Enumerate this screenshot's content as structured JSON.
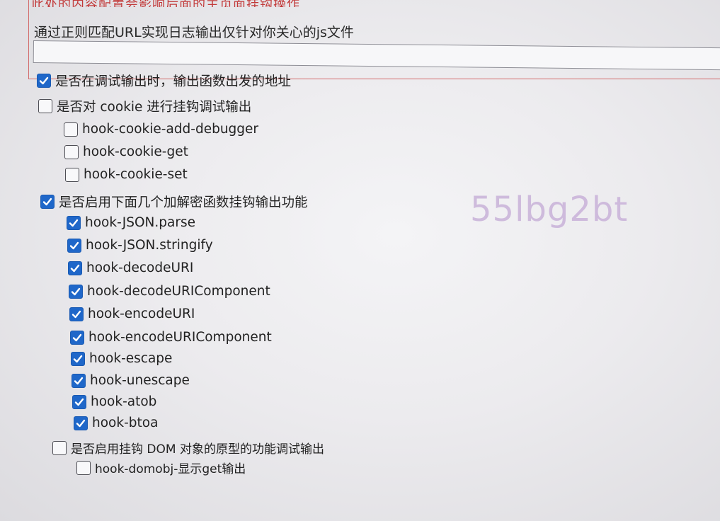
{
  "header": {
    "cut_text": "此处的内容配置会影响后面的主页面挂钩操作",
    "url_filter_label": "通过正则匹配URL实现日志输出仅针对你关心的js文件",
    "url_filter_value": ""
  },
  "options": [
    {
      "label": "是否在调试输出时，输出函数出发的地址",
      "checked": true
    },
    {
      "label": "是否对 cookie 进行挂钩调试输出",
      "checked": false
    },
    {
      "label": "hook-cookie-add-debugger",
      "checked": false
    },
    {
      "label": "hook-cookie-get",
      "checked": false
    },
    {
      "label": "hook-cookie-set",
      "checked": false
    },
    {
      "label": "是否启用下面几个加解密函数挂钩输出功能",
      "checked": true
    },
    {
      "label": "hook-JSON.parse",
      "checked": true
    },
    {
      "label": "hook-JSON.stringify",
      "checked": true
    },
    {
      "label": "hook-decodeURI",
      "checked": true
    },
    {
      "label": "hook-decodeURIComponent",
      "checked": true
    },
    {
      "label": "hook-encodeURI",
      "checked": true
    },
    {
      "label": "hook-encodeURIComponent",
      "checked": true
    },
    {
      "label": "hook-escape",
      "checked": true
    },
    {
      "label": "hook-unescape",
      "checked": true
    },
    {
      "label": "hook-atob",
      "checked": true
    },
    {
      "label": "hook-btoa",
      "checked": true
    },
    {
      "label": "是否启用挂钩 DOM 对象的原型的功能调试输出",
      "checked": false
    },
    {
      "label": "hook-domobj-显示get输出",
      "checked": false
    }
  ],
  "watermark": "55lbg2bt",
  "colors": {
    "checkbox_checked": "#1f67c9",
    "top_border": "#d26a6a",
    "watermark": "#c9b2d9"
  }
}
